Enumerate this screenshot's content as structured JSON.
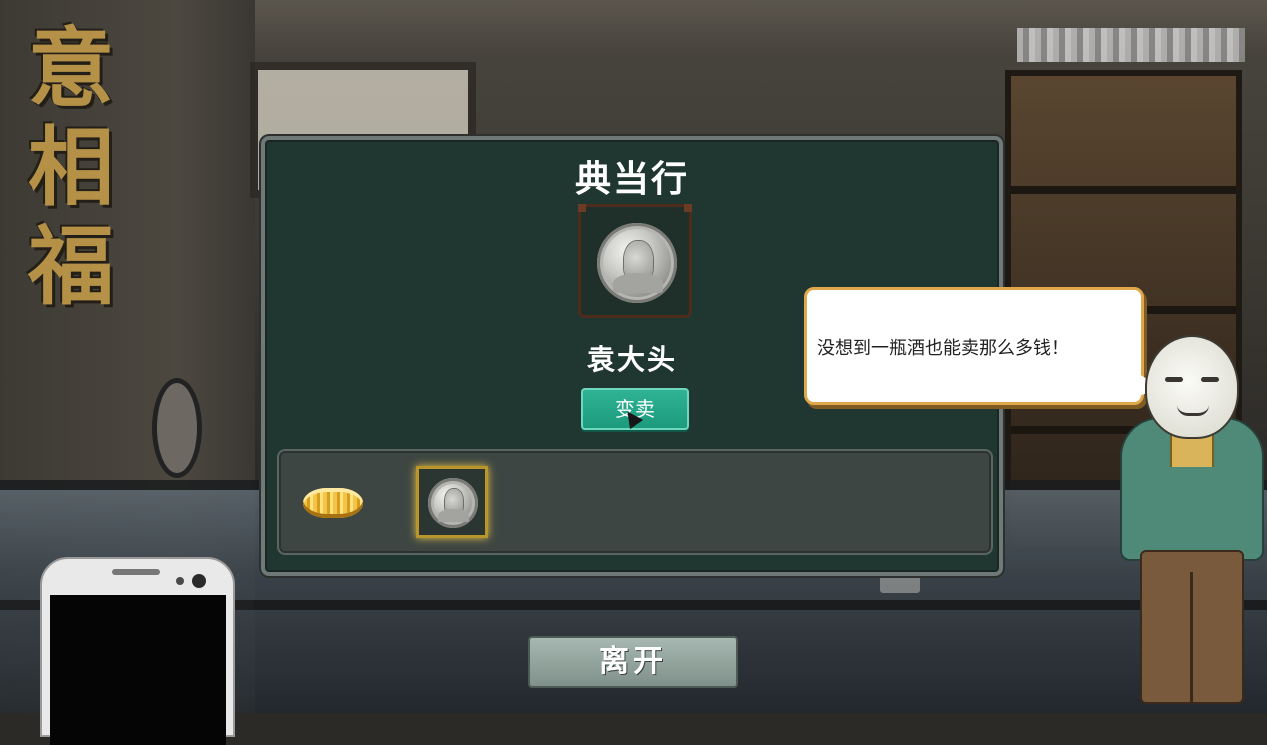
{
  "dialog": {
    "title": "典当行",
    "selected_item": {
      "name": "袁大头",
      "icon": "silver-coin-icon"
    },
    "sell_button_label": "变卖"
  },
  "inventory": {
    "items": [
      {
        "icon": "gold-ring-icon",
        "selected": false
      },
      {
        "icon": "silver-coin-icon",
        "selected": true
      }
    ]
  },
  "shopkeeper": {
    "speech": "没想到一瓶酒也能卖那么多钱！"
  },
  "background": {
    "calligraphy": [
      "意",
      "相",
      "福"
    ]
  },
  "leave_button_label": "离开",
  "colors": {
    "panel": "#203630",
    "sell_button": "#2fb394",
    "selection_glow": "#e6c44a",
    "bubble_border": "#e0a84a"
  }
}
